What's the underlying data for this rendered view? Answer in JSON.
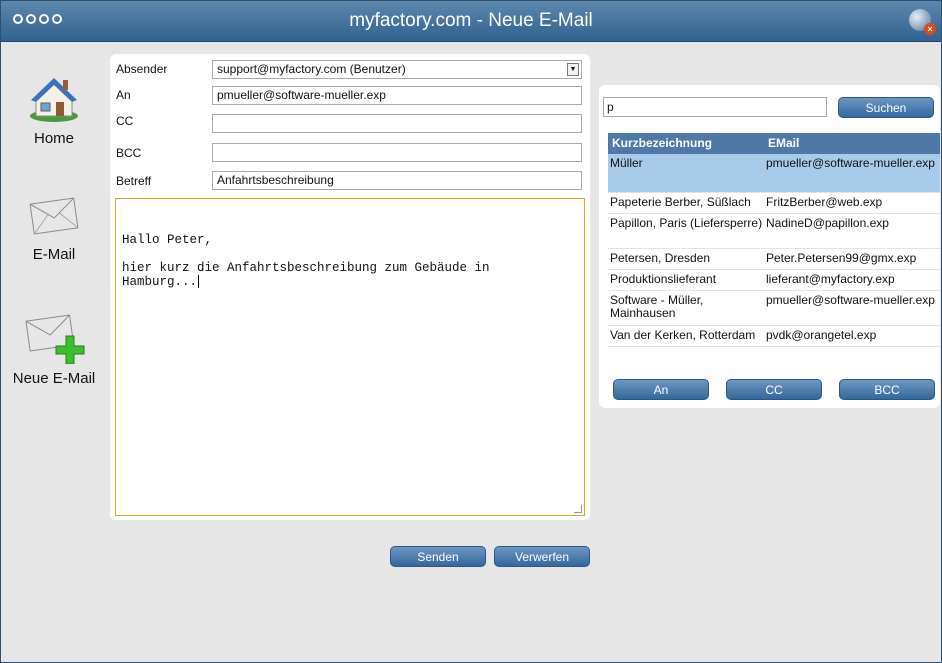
{
  "window": {
    "title": "myfactory.com - Neue E-Mail"
  },
  "sidebar": {
    "items": [
      {
        "label": "Home",
        "icon": "home-icon"
      },
      {
        "label": "E-Mail",
        "icon": "envelope-icon"
      },
      {
        "label": "Neue E-Mail",
        "icon": "new-mail-icon"
      }
    ]
  },
  "form": {
    "sender_label": "Absender",
    "sender_value": "support@myfactory.com (Benutzer)",
    "to_label": "An",
    "to_value": "pmueller@software-mueller.exp",
    "cc_label": "CC",
    "cc_value": "",
    "bcc_label": "BCC",
    "bcc_value": "",
    "subject_label": "Betreff",
    "subject_value": "Anfahrtsbeschreibung",
    "body_lines": [
      "Hallo Peter,",
      "",
      "hier kurz die Anfahrtsbeschreibung zum Gebäude in",
      "Hamburg..."
    ]
  },
  "actions": {
    "send_label": "Senden",
    "discard_label": "Verwerfen"
  },
  "search": {
    "query": "p",
    "button_label": "Suchen",
    "columns": [
      "Kurzbezeichnung",
      "EMail"
    ],
    "rows": [
      {
        "name": "Müller",
        "email": "pmueller@software-mueller.exp",
        "selected": true
      },
      {
        "name": "Papeterie Berber, Süßlach",
        "email": "FritzBerber@web.exp"
      },
      {
        "name": "Papillon, Paris (Liefersperre)",
        "email": "NadineD@papillon.exp"
      },
      {
        "name": "Petersen, Dresden",
        "email": "Peter.Petersen99@gmx.exp"
      },
      {
        "name": "Produktionslieferant",
        "email": "lieferant@myfactory.exp"
      },
      {
        "name": "Software - Müller, Mainhausen",
        "email": "pmueller@software-mueller.exp"
      },
      {
        "name": "Van der Kerken, Rotterdam",
        "email": "pvdk@orangetel.exp"
      }
    ],
    "to_button": "An",
    "cc_button": "CC",
    "bcc_button": "BCC"
  },
  "colors": {
    "titlebar": "#3f6f9c",
    "accent": "#4f79a6",
    "selected_row": "#a8cbe9",
    "focus_border": "#e3a623"
  }
}
